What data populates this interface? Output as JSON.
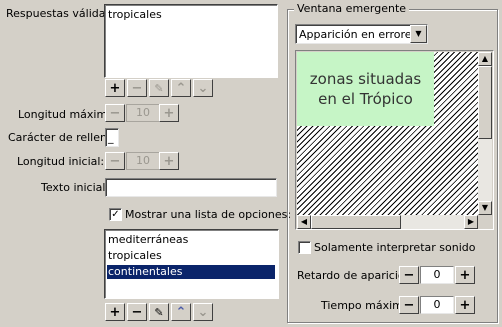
{
  "left": {
    "valid_answers_label": "Respuestas válidas:",
    "valid_answers": [
      "tropicales"
    ],
    "max_length_label": "Longitud máxima:",
    "max_length_value": "10",
    "fill_char_label": "Carácter de relleno",
    "fill_char_value": "_",
    "initial_length_label": "Longitud inicial:",
    "initial_length_value": "10",
    "initial_text_label": "Texto inicial:",
    "initial_text_value": "",
    "show_options_label": "Mostrar una lista de opciones:",
    "show_options_checked": "✓",
    "options": [
      "mediterráneas",
      "tropicales",
      "continentales"
    ],
    "selected_option_index": 2,
    "button_glyphs": {
      "add": "+",
      "remove": "−",
      "edit": "✎",
      "up": "⌃",
      "down": "⌄",
      "spin_minus": "−",
      "spin_plus": "+"
    }
  },
  "popup": {
    "group_title": "Ventana emergente",
    "mode_select_value": "Apparición en errores",
    "preview_text": "zonas situadas en el Trópico",
    "preview_color": "#c6f5c6",
    "only_sound_label": "Solamente interpretar sonido",
    "delay_label": "Retardo de aparicion:",
    "delay_value": "0",
    "max_time_label": "Tiempo máximo:",
    "max_time_value": "0"
  }
}
